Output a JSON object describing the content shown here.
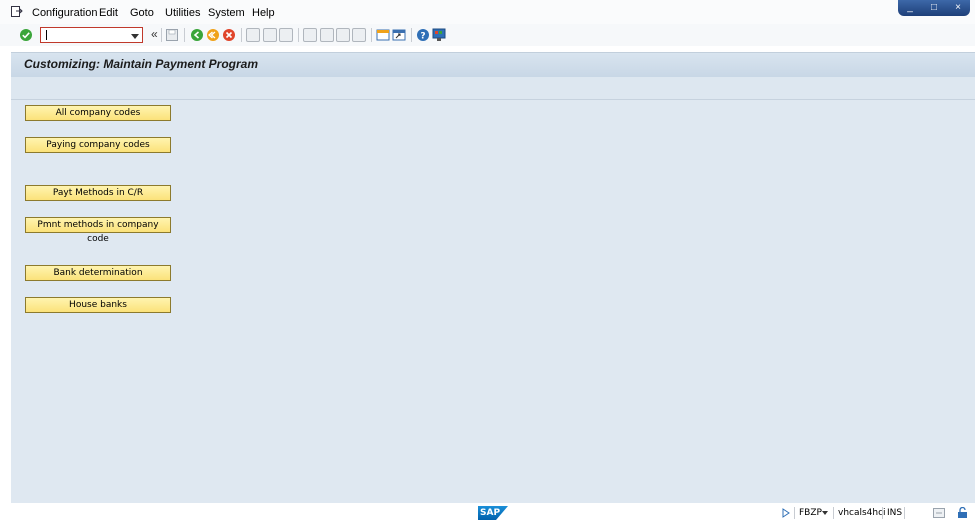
{
  "menu": {
    "items": [
      "Configuration",
      "Edit",
      "Goto",
      "Utilities",
      "System",
      "Help"
    ]
  },
  "window_controls": {
    "minimize": "_",
    "maximize": "□",
    "close": "×"
  },
  "toolbar": {
    "command_value": "",
    "icons": [
      "enter-icon",
      "back-icon",
      "exit-icon",
      "cancel-icon",
      "save-icon",
      "print-icon",
      "find-icon",
      "find-next-icon",
      "first-page-icon",
      "prev-page-icon",
      "next-page-icon",
      "last-page-icon",
      "new-session-icon",
      "shortcut-icon",
      "help-icon",
      "customize-layout-icon"
    ],
    "history_glyph": "«"
  },
  "screen": {
    "title": "Customizing: Maintain Payment Program"
  },
  "buttons": [
    "All company codes",
    "Paying company codes",
    "Payt Methods in C/R",
    "Pmnt methods in company code",
    "Bank determination",
    "House banks"
  ],
  "status": {
    "logo": "SAP",
    "transaction": "FBZP",
    "server": "vhcals4hci",
    "mode": "INS"
  },
  "colors": {
    "button_fill": "#fbe27a",
    "title_bar": "#c8d7e6",
    "content_bg": "#dfe8f1",
    "command_border": "#c0392b"
  }
}
